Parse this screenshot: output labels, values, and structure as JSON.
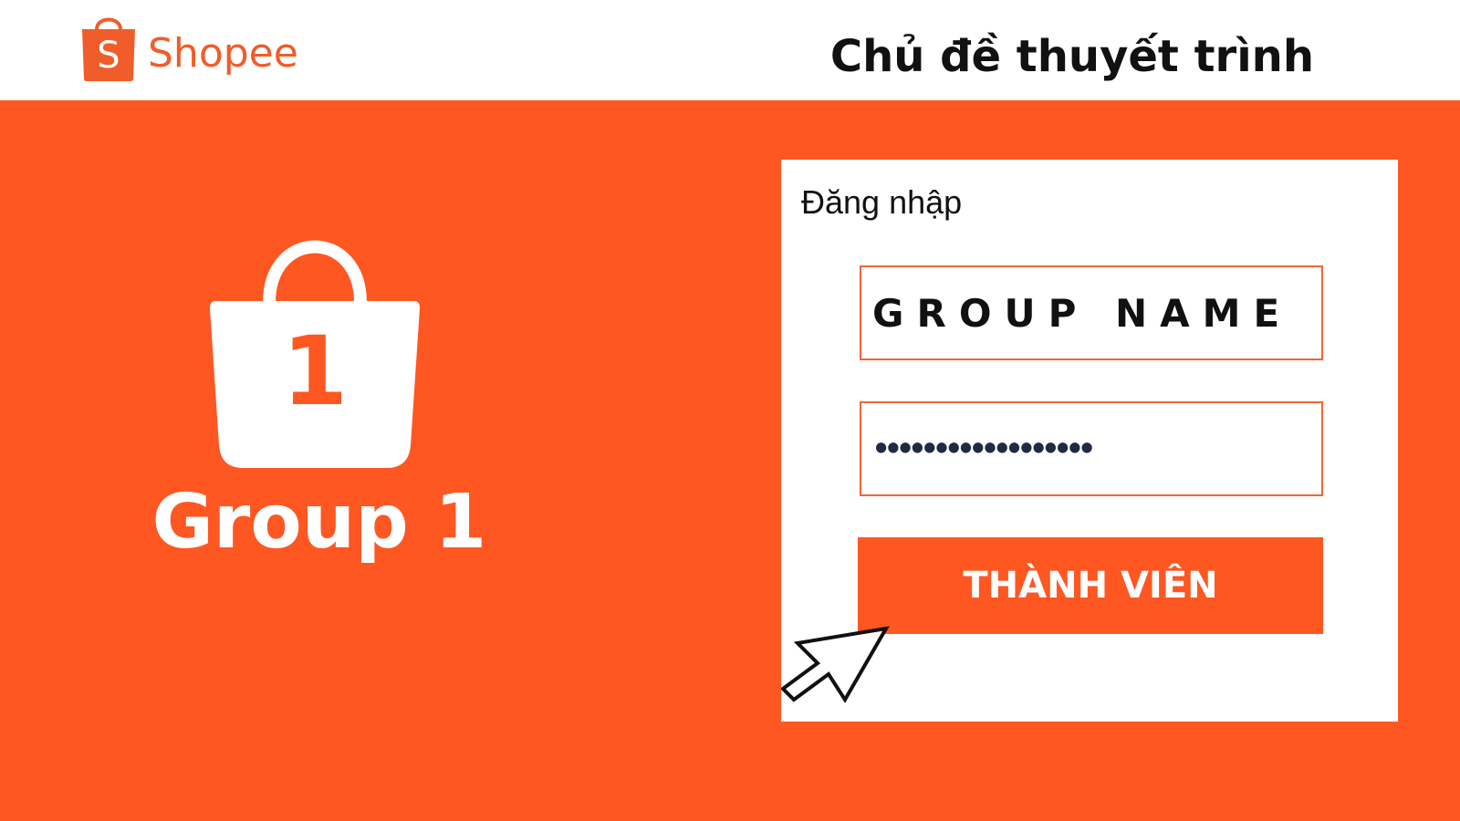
{
  "header": {
    "brand_initial": "S",
    "brand_name": "Shopee",
    "title": "Chủ đề thuyết trình"
  },
  "hero": {
    "number": "1",
    "label": "Group 1",
    "icon": "shopping-bag-icon"
  },
  "login": {
    "heading": "Đăng nhập",
    "username_value": "GROUP NAME",
    "password_value": "••••••••••••••••••",
    "button_label": "THÀNH VIÊN"
  },
  "cursor": {
    "icon": "mouse-pointer-icon"
  },
  "colors": {
    "accent": "#fe5722",
    "brand": "#f05d2a",
    "card": "#ffffff",
    "text": "#111111"
  }
}
